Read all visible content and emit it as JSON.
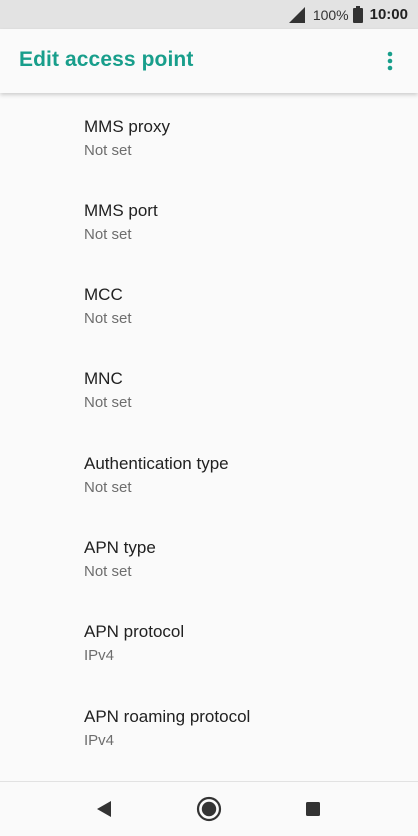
{
  "status_bar": {
    "battery_percent": "100%",
    "time": "10:00",
    "signal_icon": "cell-signal-icon",
    "battery_icon": "battery-full-icon"
  },
  "app_bar": {
    "title": "Edit access point",
    "menu_icon": "more-vert-icon"
  },
  "preferences": [
    {
      "title": "MMS proxy",
      "summary": "Not set"
    },
    {
      "title": "MMS port",
      "summary": "Not set"
    },
    {
      "title": "MCC",
      "summary": "Not set"
    },
    {
      "title": "MNC",
      "summary": "Not set"
    },
    {
      "title": "Authentication type",
      "summary": "Not set"
    },
    {
      "title": "APN type",
      "summary": "Not set"
    },
    {
      "title": "APN protocol",
      "summary": "IPv4"
    },
    {
      "title": "APN roaming protocol",
      "summary": "IPv4"
    }
  ],
  "nav_bar": {
    "back_icon": "back-triangle-icon",
    "home_icon": "home-circle-icon",
    "recents_icon": "recents-square-icon"
  },
  "colors": {
    "accent": "#189e8b",
    "status_bar_bg": "#e3e3e3",
    "background": "#fafafa"
  }
}
